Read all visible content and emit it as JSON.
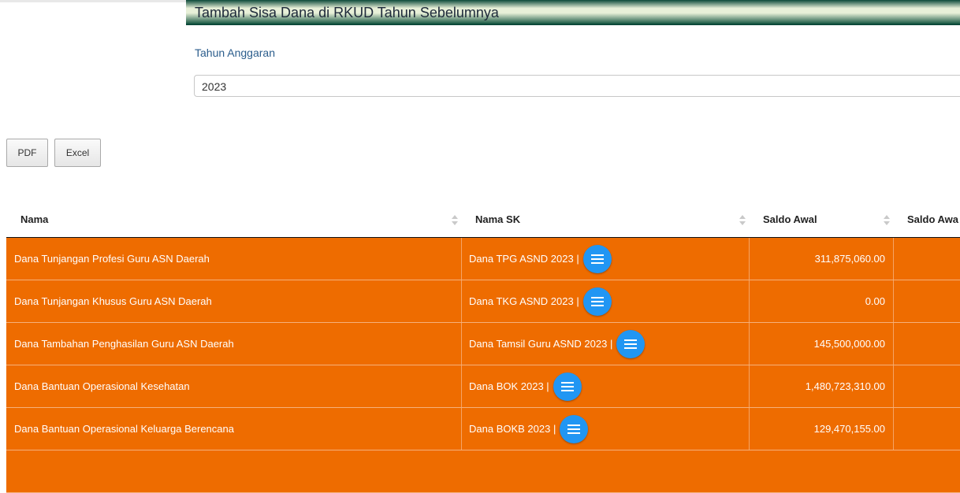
{
  "page": {
    "title": "Tambah Sisa Dana di RKUD Tahun Sebelumnya",
    "year_label": "Tahun Anggaran",
    "year_value": "2023"
  },
  "toolbar": {
    "pdf_label": "PDF",
    "excel_label": "Excel"
  },
  "table": {
    "headers": {
      "nama": "Nama",
      "nama_sk": "Nama SK",
      "saldo_awal": "Saldo Awal",
      "saldo_awal_2": "Saldo Awa"
    },
    "rows": [
      {
        "nama": "Dana Tunjangan Profesi Guru ASN Daerah",
        "nama_sk": "Dana TPG ASND 2023 |",
        "saldo_awal": "311,875,060.00"
      },
      {
        "nama": "Dana Tunjangan Khusus Guru ASN Daerah",
        "nama_sk": "Dana TKG ASND 2023 |",
        "saldo_awal": "0.00"
      },
      {
        "nama": "Dana Tambahan Penghasilan Guru ASN Daerah",
        "nama_sk": "Dana Tamsil Guru ASND 2023 |",
        "saldo_awal": "145,500,000.00"
      },
      {
        "nama": "Dana Bantuan Operasional Kesehatan",
        "nama_sk": "Dana BOK 2023 |",
        "saldo_awal": "1,480,723,310.00"
      },
      {
        "nama": "Dana Bantuan Operasional Keluarga Berencana",
        "nama_sk": "Dana BOKB 2023 |",
        "saldo_awal": "129,470,155.00"
      }
    ]
  },
  "colors": {
    "row_background": "#ee6c00",
    "menu_button": "#2196f3",
    "title_bar": "#0c4a3a"
  },
  "icons": {
    "row_action": "menu-icon",
    "sort": "sort-icon"
  }
}
